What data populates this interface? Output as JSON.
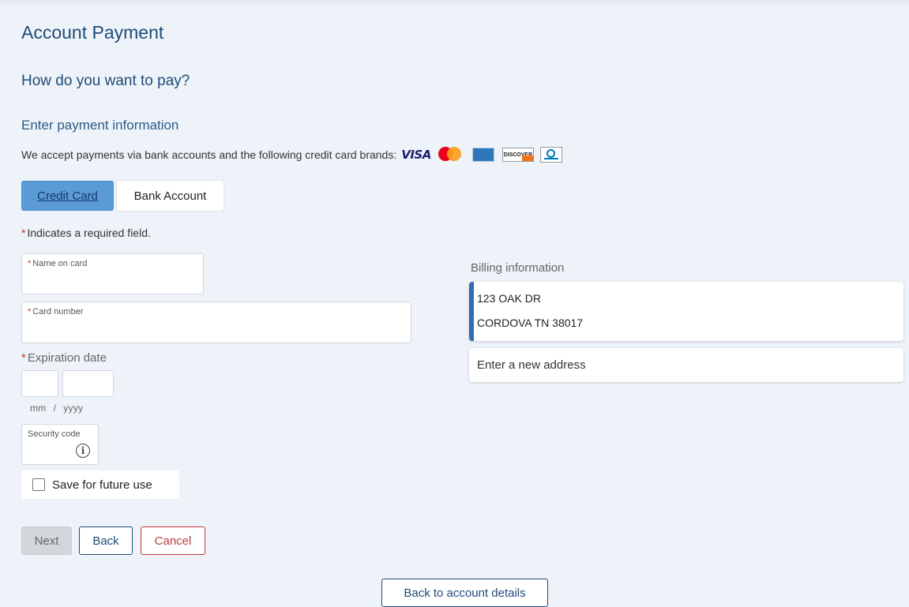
{
  "page": {
    "title": "Account Payment",
    "question": "How do you want to pay?",
    "section_title": "Enter payment information",
    "accept_text": "We accept payments via bank accounts and the following credit card brands:",
    "card_brands": [
      "VISA",
      "Mastercard",
      "American Express",
      "DISCOVER",
      "Diners Club"
    ],
    "discover_label": "DISCOVER",
    "visa_label": "VISA"
  },
  "tabs": {
    "credit_card": "Credit Card",
    "bank_account": "Bank Account",
    "selected": "Credit Card"
  },
  "form": {
    "required_star": "*",
    "required_note": "Indicates a required field.",
    "name_on_card_label": "Name on card",
    "name_on_card_value": "",
    "card_number_label": "Card number",
    "card_number_value": "",
    "expiration_label": "Expiration date",
    "mm_hint": "mm",
    "yyyy_hint": "yyyy",
    "date_separator": "/",
    "security_code_label": "Security code",
    "info_icon": "i",
    "save_label": "Save for future use",
    "save_checked": false
  },
  "billing": {
    "label": "Billing information",
    "address_line1": "123 OAK DR",
    "address_line2": "CORDOVA TN 38017",
    "new_address": "Enter a new address"
  },
  "buttons": {
    "next": "Next",
    "back": "Back",
    "cancel": "Cancel",
    "back_to_account": "Back to account details"
  },
  "colors": {
    "heading": "#1f4b78",
    "selected_tab": "#5b9bd5",
    "required_star": "#c0392b",
    "cancel": "#c0393b",
    "address_accent": "#2f6eb5"
  }
}
